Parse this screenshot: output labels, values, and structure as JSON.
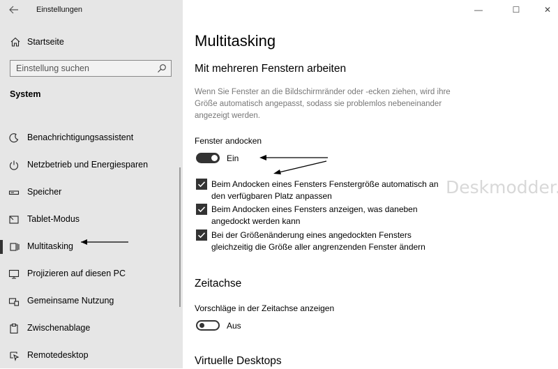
{
  "window": {
    "title": "Einstellungen",
    "back_icon": "back-arrow-icon",
    "controls": {
      "minimize": "—",
      "maximize": "☐",
      "close": "✕"
    }
  },
  "sidebar": {
    "home_label": "Startseite",
    "search_placeholder": "Einstellung suchen",
    "section": "System",
    "items": [
      {
        "label": "Benachrichtigungsassistent",
        "icon": "focus-assist-icon"
      },
      {
        "label": "Netzbetrieb und Energiesparen",
        "icon": "power-icon"
      },
      {
        "label": "Speicher",
        "icon": "storage-icon"
      },
      {
        "label": "Tablet-Modus",
        "icon": "tablet-mode-icon"
      },
      {
        "label": "Multitasking",
        "icon": "multitasking-icon",
        "selected": true
      },
      {
        "label": "Projizieren auf diesen PC",
        "icon": "projecting-icon"
      },
      {
        "label": "Gemeinsame Nutzung",
        "icon": "shared-experiences-icon"
      },
      {
        "label": "Zwischenablage",
        "icon": "clipboard-icon"
      },
      {
        "label": "Remotedesktop",
        "icon": "remote-desktop-icon"
      }
    ]
  },
  "main": {
    "title": "Multitasking",
    "snap_section": {
      "heading": "Mit mehreren Fenstern arbeiten",
      "description": "Wenn Sie Fenster an die Bildschirmränder oder -ecken ziehen, wird ihre Größe automatisch angepasst, sodass sie problemlos nebeneinander angezeigt werden.",
      "toggle_label": "Fenster andocken",
      "toggle_state": "Ein",
      "toggle_on": true,
      "options": [
        {
          "label": "Beim Andocken eines Fensters Fenstergröße automatisch an den verfügbaren Platz anpassen",
          "checked": true
        },
        {
          "label": "Beim Andocken eines Fensters anzeigen, was daneben angedockt werden kann",
          "checked": true
        },
        {
          "label": "Bei der Größenänderung eines angedockten Fensters gleichzeitig die Größe aller angrenzenden Fenster ändern",
          "checked": true
        }
      ]
    },
    "timeline_section": {
      "heading": "Zeitachse",
      "toggle_label": "Vorschläge in der Zeitachse anzeigen",
      "toggle_state": "Aus",
      "toggle_on": false
    },
    "virtual_desktops_heading": "Virtuelle Desktops"
  },
  "watermark": "Deskmodder.de",
  "colors": {
    "sidebar_bg": "#e6e6e6",
    "toggle_dark": "#333333",
    "description": "#777777"
  }
}
